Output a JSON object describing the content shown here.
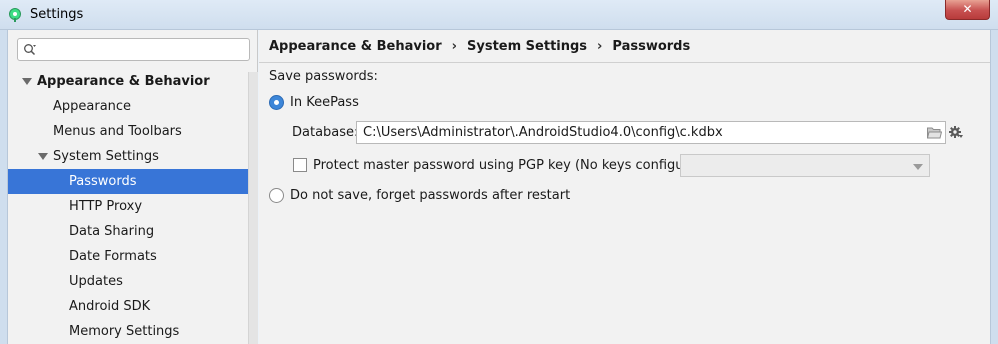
{
  "window": {
    "title": "Settings",
    "close_glyph": "✕"
  },
  "search": {
    "value": "",
    "placeholder": ""
  },
  "sidebar": {
    "items": [
      {
        "label": "Appearance & Behavior"
      },
      {
        "label": "Appearance"
      },
      {
        "label": "Menus and Toolbars"
      },
      {
        "label": "System Settings"
      },
      {
        "label": "Passwords"
      },
      {
        "label": "HTTP Proxy"
      },
      {
        "label": "Data Sharing"
      },
      {
        "label": "Date Formats"
      },
      {
        "label": "Updates"
      },
      {
        "label": "Android SDK"
      },
      {
        "label": "Memory Settings"
      }
    ],
    "selected": "Passwords"
  },
  "breadcrumb": {
    "part1": "Appearance & Behavior",
    "part2": "System Settings",
    "part3": "Passwords",
    "separator": "›"
  },
  "passwords": {
    "save_label": "Save passwords:",
    "keepass_label": "In KeePass",
    "keepass_selected": true,
    "database_label": "Database:",
    "database_value": "C:\\Users\\Administrator\\.AndroidStudio4.0\\config\\c.kdbx",
    "pgp_label": "Protect master password using PGP key (No keys configured)",
    "pgp_checked": false,
    "pgp_select_value": "",
    "no_save_label": "Do not save, forget passwords after restart"
  },
  "colors": {
    "selection": "#3875d7",
    "radio_accent": "#3d86d8"
  }
}
